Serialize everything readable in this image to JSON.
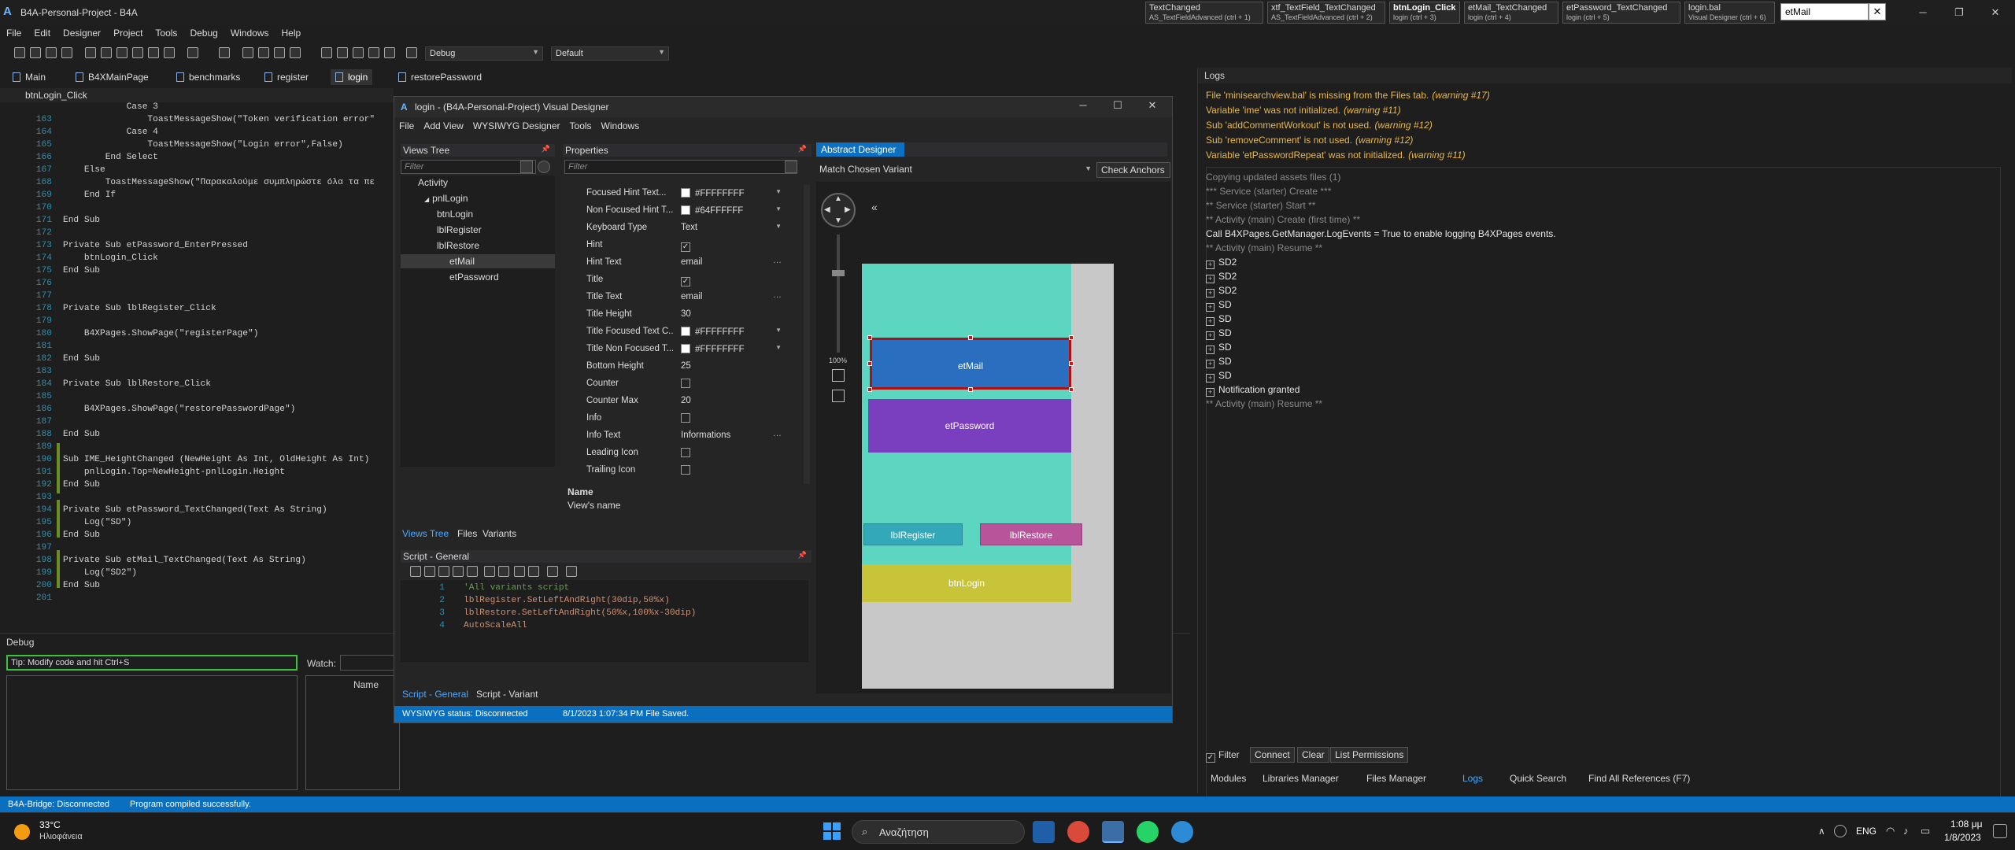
{
  "window": {
    "title": "B4A-Personal-Project - B4A",
    "nav_tabs": [
      {
        "title": "TextChanged",
        "sub": "AS_TextFieldAdvanced  (ctrl + 1)"
      },
      {
        "title": "xtf_TextField_TextChanged",
        "sub": "AS_TextFieldAdvanced  (ctrl + 2)"
      },
      {
        "title": "btnLogin_Click",
        "sub": "login  (ctrl + 3)"
      },
      {
        "title": "etMail_TextChanged",
        "sub": "login  (ctrl + 4)"
      },
      {
        "title": "etPassword_TextChanged",
        "sub": "login  (ctrl + 5)"
      },
      {
        "title": "login.bal",
        "sub": "Visual Designer  (ctrl + 6)"
      }
    ],
    "search_value": "etMail"
  },
  "menu": [
    "File",
    "Edit",
    "Designer",
    "Project",
    "Tools",
    "Debug",
    "Windows",
    "Help"
  ],
  "toolbar": {
    "build_config": "Debug",
    "platform": "Default"
  },
  "file_tabs": [
    "Main",
    "B4XMainPage",
    "benchmarks",
    "register",
    "login",
    "restorePassword"
  ],
  "active_file_tab": "login",
  "editor": {
    "current_sub": "btnLogin_Click",
    "lines": [
      {
        "n": "",
        "t": "            Case 3"
      },
      {
        "n": "163",
        "t": "                ToastMessageShow(\"Token verification error\""
      },
      {
        "n": "164",
        "t": "            Case 4"
      },
      {
        "n": "165",
        "t": "                ToastMessageShow(\"Login error\",False)"
      },
      {
        "n": "166",
        "t": "        End Select"
      },
      {
        "n": "167",
        "t": "    Else"
      },
      {
        "n": "168",
        "t": "        ToastMessageShow(\"Παρακαλούμε συμπληρώστε όλα τα πε"
      },
      {
        "n": "169",
        "t": "    End If"
      },
      {
        "n": "170",
        "t": ""
      },
      {
        "n": "171",
        "t": "End Sub"
      },
      {
        "n": "172",
        "t": ""
      },
      {
        "n": "173",
        "t": "Private Sub etPassword_EnterPressed"
      },
      {
        "n": "174",
        "t": "    btnLogin_Click"
      },
      {
        "n": "175",
        "t": "End Sub"
      },
      {
        "n": "176",
        "t": ""
      },
      {
        "n": "177",
        "t": ""
      },
      {
        "n": "178",
        "t": "Private Sub lblRegister_Click"
      },
      {
        "n": "179",
        "t": ""
      },
      {
        "n": "180",
        "t": "    B4XPages.ShowPage(\"registerPage\")"
      },
      {
        "n": "181",
        "t": ""
      },
      {
        "n": "182",
        "t": "End Sub"
      },
      {
        "n": "183",
        "t": ""
      },
      {
        "n": "184",
        "t": "Private Sub lblRestore_Click"
      },
      {
        "n": "185",
        "t": ""
      },
      {
        "n": "186",
        "t": "    B4XPages.ShowPage(\"restorePasswordPage\")"
      },
      {
        "n": "187",
        "t": ""
      },
      {
        "n": "188",
        "t": "End Sub"
      },
      {
        "n": "189",
        "t": ""
      },
      {
        "n": "190",
        "t": "Sub IME_HeightChanged (NewHeight As Int, OldHeight As Int)"
      },
      {
        "n": "191",
        "t": "    pnlLogin.Top=NewHeight-pnlLogin.Height"
      },
      {
        "n": "192",
        "t": "End Sub"
      },
      {
        "n": "193",
        "t": ""
      },
      {
        "n": "194",
        "t": "Private Sub etPassword_TextChanged(Text As String)"
      },
      {
        "n": "195",
        "t": "    Log(\"SD\")"
      },
      {
        "n": "196",
        "t": "End Sub"
      },
      {
        "n": "197",
        "t": ""
      },
      {
        "n": "198",
        "t": "Private Sub etMail_TextChanged(Text As String)"
      },
      {
        "n": "199",
        "t": "    Log(\"SD2\")"
      },
      {
        "n": "200",
        "t": "End Sub"
      },
      {
        "n": "201",
        "t": ""
      }
    ]
  },
  "debug": {
    "title": "Debug",
    "tip": "Tip: Modify code and hit Ctrl+S",
    "watch_label": "Watch:",
    "name_col": "Name"
  },
  "designer": {
    "title": "login - (B4A-Personal-Project) Visual Designer",
    "menu": [
      "File",
      "Add View",
      "WYSIWYG Designer",
      "Tools",
      "Windows"
    ],
    "views_tree_title": "Views Tree",
    "filter_placeholder": "Filter",
    "tree": [
      "Activity",
      "pnlLogin",
      "btnLogin",
      "lblRegister",
      "lblRestore",
      "etMail",
      "etPassword"
    ],
    "selected_tree": "etMail",
    "left_tabs": [
      "Views Tree",
      "Files",
      "Variants"
    ],
    "properties_title": "Properties",
    "properties": [
      {
        "name": "Focused Hint Text...",
        "value": "#FFFFFFFF",
        "kind": "color"
      },
      {
        "name": "Non Focused Hint T...",
        "value": "#64FFFFFF",
        "kind": "color"
      },
      {
        "name": "Keyboard Type",
        "value": "Text",
        "kind": "dropdown"
      },
      {
        "name": "Hint",
        "value": "✓",
        "kind": "check"
      },
      {
        "name": "Hint Text",
        "value": "email",
        "kind": "text"
      },
      {
        "name": "Title",
        "value": "✓",
        "kind": "check"
      },
      {
        "name": "Title Text",
        "value": "email",
        "kind": "text"
      },
      {
        "name": "Title Height",
        "value": "30",
        "kind": "plain"
      },
      {
        "name": "Title Focused Text C...",
        "value": "#FFFFFFFF",
        "kind": "color"
      },
      {
        "name": "Title Non Focused T...",
        "value": "#FFFFFFFF",
        "kind": "color"
      },
      {
        "name": "Bottom Height",
        "value": "25",
        "kind": "plain"
      },
      {
        "name": "Counter",
        "value": "",
        "kind": "check"
      },
      {
        "name": "Counter Max",
        "value": "20",
        "kind": "plain"
      },
      {
        "name": "Info",
        "value": "",
        "kind": "check"
      },
      {
        "name": "Info Text",
        "value": "Informations",
        "kind": "text"
      },
      {
        "name": "Leading Icon",
        "value": "",
        "kind": "check"
      },
      {
        "name": "Trailing Icon",
        "value": "",
        "kind": "check"
      }
    ],
    "prop_desc_title": "Name",
    "prop_desc_text": "View's name",
    "abstract_designer": "Abstract Designer",
    "variant": "Match Chosen Variant",
    "check_anchors": "Check Anchors",
    "zoom": "100%",
    "views": {
      "etMail": "etMail",
      "etPassword": "etPassword",
      "lblRegister": "lblRegister",
      "lblRestore": "lblRestore",
      "btnLogin": "btnLogin"
    },
    "script_title": "Script - General",
    "script_lines": [
      {
        "n": "1",
        "t": "'All variants script"
      },
      {
        "n": "2",
        "t": "lblRegister.SetLeftAndRight(30dip,50%x)"
      },
      {
        "n": "3",
        "t": "lblRestore.SetLeftAndRight(50%x,100%x-30dip)"
      },
      {
        "n": "4",
        "t": "AutoScaleAll"
      }
    ],
    "script_tabs": [
      "Script - General",
      "Script - Variant"
    ],
    "status": "WYSIWYG status: Disconnected",
    "saved": "8/1/2023 1:07:34 PM   File Saved."
  },
  "logs": {
    "title": "Logs",
    "warnings": [
      {
        "t": "File 'minisearchview.bal' is missing from the Files tab.",
        "w": "(warning #17)"
      },
      {
        "t": "Variable 'ime' was not initialized.",
        "w": "(warning #11)"
      },
      {
        "t": "Sub 'addCommentWorkout' is not used.",
        "w": "(warning #12)"
      },
      {
        "t": "Sub 'removeComment' is not used.",
        "w": "(warning #12)"
      },
      {
        "t": "Variable 'etPasswordRepeat' was not initialized.",
        "w": "(warning #11)"
      }
    ],
    "lines": [
      {
        "t": "Copying updated assets files (1)",
        "c": "grey",
        "box": false
      },
      {
        "t": "*** Service (starter) Create ***",
        "c": "grey",
        "box": false
      },
      {
        "t": "** Service (starter) Start **",
        "c": "grey",
        "box": false
      },
      {
        "t": "** Activity (main) Create (first time) **",
        "c": "grey",
        "box": false
      },
      {
        "t": "Call B4XPages.GetManager.LogEvents = True to enable logging B4XPages events.",
        "c": "white",
        "box": false
      },
      {
        "t": "** Activity (main) Resume **",
        "c": "grey",
        "box": false
      },
      {
        "t": "SD2",
        "c": "white",
        "box": true
      },
      {
        "t": "SD2",
        "c": "white",
        "box": true
      },
      {
        "t": "SD2",
        "c": "white",
        "box": true
      },
      {
        "t": "SD",
        "c": "white",
        "box": true
      },
      {
        "t": "SD",
        "c": "white",
        "box": true
      },
      {
        "t": "SD",
        "c": "white",
        "box": true
      },
      {
        "t": "SD",
        "c": "white",
        "box": true
      },
      {
        "t": "SD",
        "c": "white",
        "box": true
      },
      {
        "t": "SD",
        "c": "white",
        "box": true
      },
      {
        "t": "Notification granted",
        "c": "white",
        "box": true
      },
      {
        "t": "** Activity (main) Resume **",
        "c": "grey",
        "box": false
      }
    ],
    "filter_label": "Filter",
    "buttons": [
      "Connect",
      "Clear",
      "List Permissions"
    ],
    "bottom_tabs": [
      "Modules",
      "Libraries Manager",
      "Files Manager",
      "Logs",
      "Quick Search",
      "Find All References (F7)"
    ]
  },
  "status_bar": {
    "bridge": "B4A-Bridge: Disconnected",
    "message": "Program compiled successfully."
  },
  "taskbar": {
    "temp": "33°C",
    "weather": "Ηλιοφάνεια",
    "search": "Αναζήτηση",
    "lang": "ENG",
    "time": "1:08 μμ",
    "date": "1/8/2023"
  }
}
